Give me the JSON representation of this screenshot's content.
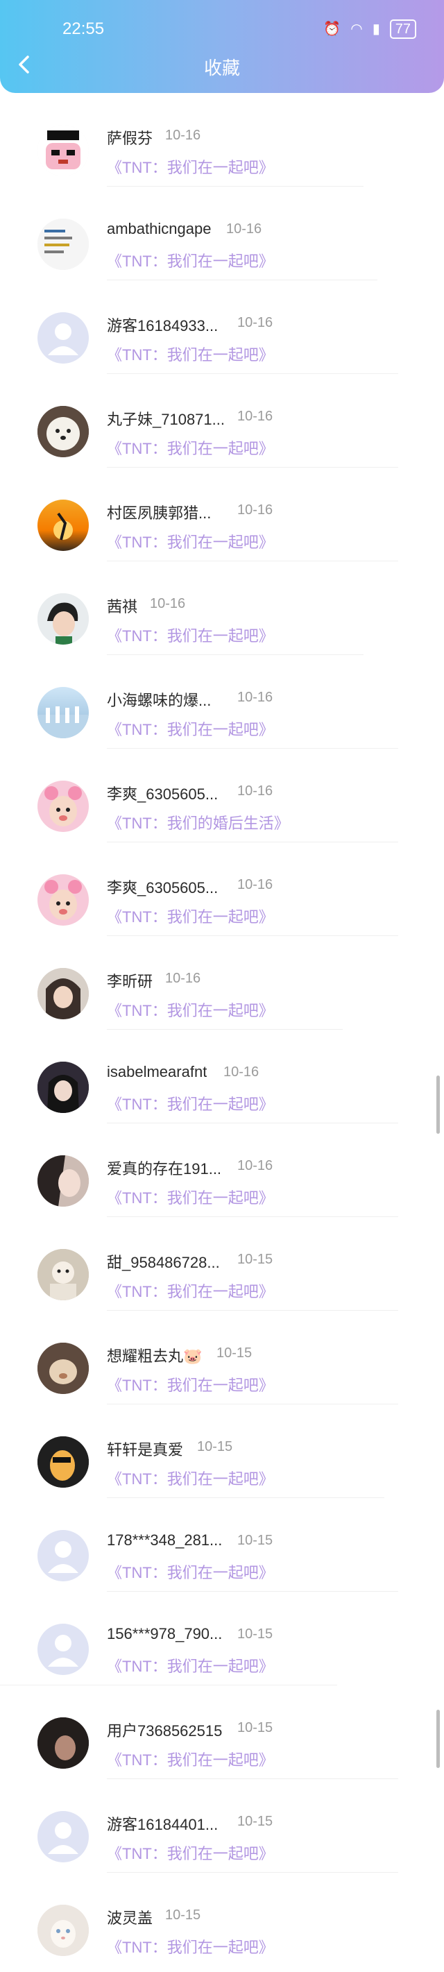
{
  "status": {
    "time": "22:55",
    "battery": "77"
  },
  "header": {
    "title": "收藏"
  },
  "items": [
    {
      "name": "萨假芬",
      "date": "10-16",
      "work": "《TNT：我们在一起吧》"
    },
    {
      "name": "ambathicngape",
      "date": "10-16",
      "work": "《TNT：我们在一起吧》"
    },
    {
      "name": "游客16184933...",
      "date": "10-16",
      "work": "《TNT：我们在一起吧》"
    },
    {
      "name": "丸子妹_710871...",
      "date": "10-16",
      "work": "《TNT：我们在一起吧》"
    },
    {
      "name": "村医夙胰郭猎...",
      "date": "10-16",
      "work": "《TNT：我们在一起吧》"
    },
    {
      "name": "茜祺",
      "date": "10-16",
      "work": "《TNT：我们在一起吧》"
    },
    {
      "name": "小海螺味的爆...",
      "date": "10-16",
      "work": "《TNT：我们在一起吧》"
    },
    {
      "name": "李爽_6305605...",
      "date": "10-16",
      "work": "《TNT：我们的婚后生活》"
    },
    {
      "name": "李爽_6305605...",
      "date": "10-16",
      "work": "《TNT：我们在一起吧》"
    },
    {
      "name": "李昕研",
      "date": "10-16",
      "work": "《TNT：我们在一起吧》"
    },
    {
      "name": "isabelmearafnt",
      "date": "10-16",
      "work": "《TNT：我们在一起吧》"
    },
    {
      "name": "爱真的存在191...",
      "date": "10-16",
      "work": "《TNT：我们在一起吧》"
    },
    {
      "name": "甜_958486728...",
      "date": "10-15",
      "work": "《TNT：我们在一起吧》"
    },
    {
      "name": "想耀粗去丸🐷",
      "date": "10-15",
      "work": "《TNT：我们在一起吧》"
    },
    {
      "name": "轩轩是真爱",
      "date": "10-15",
      "work": "《TNT：我们在一起吧》"
    },
    {
      "name": "178***348_281...",
      "date": "10-15",
      "work": "《TNT：我们在一起吧》"
    },
    {
      "name": "156***978_790...",
      "date": "10-15",
      "work": "《TNT：我们在一起吧》"
    },
    {
      "name": "用户7368562515",
      "date": "10-15",
      "work": "《TNT：我们在一起吧》"
    },
    {
      "name": "游客16184401...",
      "date": "10-15",
      "work": "《TNT：我们在一起吧》"
    },
    {
      "name": "波灵盖",
      "date": "10-15",
      "work": "《TNT：我们在一起吧》"
    }
  ]
}
